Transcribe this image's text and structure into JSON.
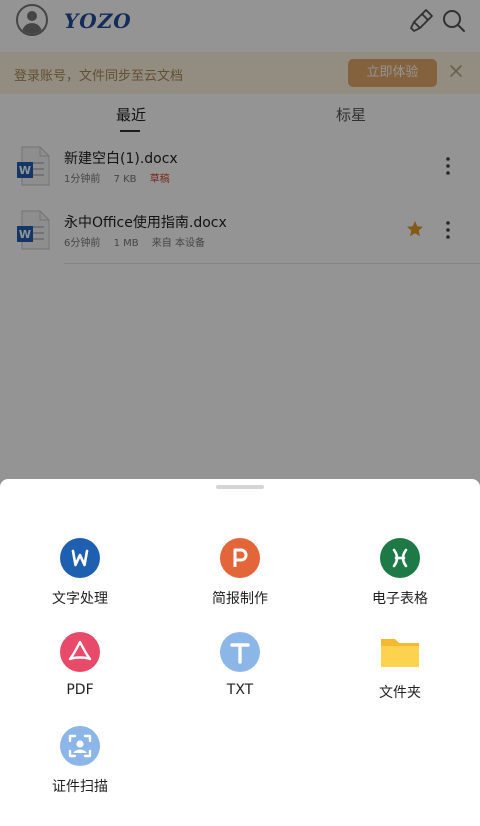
{
  "header": {
    "logo_text": "YOZO",
    "avatar_icon": "user-avatar-icon",
    "clean_icon": "brush-icon",
    "search_icon": "search-icon"
  },
  "banner": {
    "text": "登录账号，文件同步至云文档",
    "button_label": "立即体验",
    "close_icon": "close-icon"
  },
  "tabs": [
    {
      "label": "最近",
      "active": true
    },
    {
      "label": "标星",
      "active": false
    }
  ],
  "files": [
    {
      "name": "新建空白(1).docx",
      "time": "1分钟前",
      "size": "7 KB",
      "extra": "草稿",
      "starred": false
    },
    {
      "name": "永中Office使用指南.docx",
      "time": "6分钟前",
      "size": "1 MB",
      "extra": "来自 本设备",
      "starred": true
    }
  ],
  "sheet": {
    "items": [
      {
        "label": "文字处理",
        "icon": "word-processor-icon",
        "color": "#1f5fb0",
        "glyph": "W"
      },
      {
        "label": "简报制作",
        "icon": "presentation-icon",
        "color": "#e2663a",
        "glyph": "P"
      },
      {
        "label": "电子表格",
        "icon": "spreadsheet-icon",
        "color": "#1d7a46",
        "glyph": "X"
      },
      {
        "label": "PDF",
        "icon": "pdf-icon",
        "color": "#e84a6a",
        "glyph": ""
      },
      {
        "label": "TXT",
        "icon": "txt-icon",
        "color": "#8cb6e8",
        "glyph": "T"
      },
      {
        "label": "文件夹",
        "icon": "folder-icon",
        "color": "#f7c23a",
        "glyph": ""
      },
      {
        "label": "证件扫描",
        "icon": "id-scan-icon",
        "color": "#8cb6e8",
        "glyph": ""
      }
    ]
  },
  "colors": {
    "accent": "#e2a96a",
    "draft": "#d0462b",
    "star": "#e39b2b",
    "overlay": "rgba(0,0,0,0.42)"
  }
}
